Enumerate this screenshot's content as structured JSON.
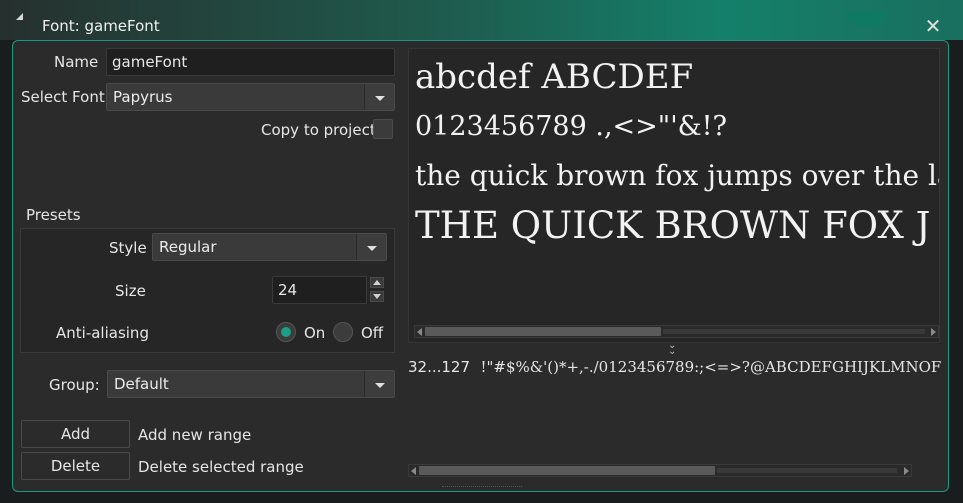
{
  "window": {
    "title": "Font: gameFont",
    "close_icon": "close-icon"
  },
  "form": {
    "name_label": "Name",
    "name_value": "gameFont",
    "select_font_label": "Select Font",
    "select_font_value": "Papyrus",
    "copy_label": "Copy to project",
    "copy_checked": false
  },
  "presets": {
    "heading": "Presets",
    "style_label": "Style",
    "style_value": "Regular",
    "size_label": "Size",
    "size_value": "24",
    "aa_label": "Anti-aliasing",
    "aa_on": "On",
    "aa_off": "Off",
    "aa_selected": "On"
  },
  "group": {
    "label": "Group:",
    "value": "Default"
  },
  "ranges": {
    "add_button": "Add",
    "add_desc": "Add new range",
    "delete_button": "Delete",
    "delete_desc": "Delete selected range",
    "range_value": "32...127",
    "range_chars": "!\"#$%&'()*+,-./0123456789:;<=>?@ABCDEFGHIJKLMNOF"
  },
  "preview": {
    "lines": [
      "abcdef ABCDEF",
      "0123456789 .,<>\"'&!?",
      "the quick brown fox jumps over the lazy",
      "THE QUICK BROWN FOX J"
    ]
  },
  "colors": {
    "accent": "#1aa086",
    "border": "#199a7f"
  }
}
